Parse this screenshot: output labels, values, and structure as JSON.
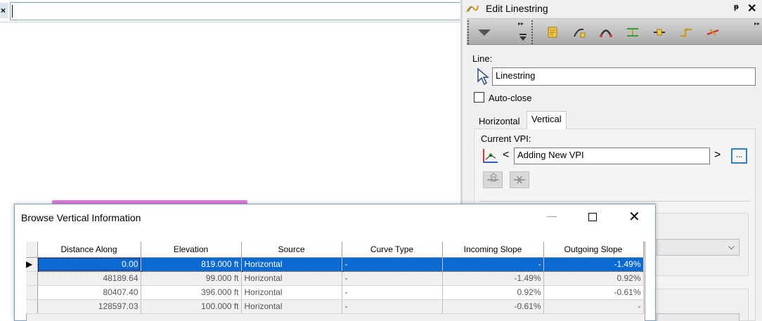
{
  "left_tab": {
    "close_glyph": "×"
  },
  "panel": {
    "title": "Edit Linestring",
    "pin_glyph": "ᵽ",
    "close_glyph": "✕",
    "line_label": "Line:",
    "line_value": "Linestring",
    "auto_close_label": "Auto-close",
    "tabs": [
      "Horizontal",
      "Vertical"
    ],
    "active_tab": "Vertical",
    "current_vpi_label": "Current VPI:",
    "current_vpi_value": "Adding New VPI",
    "prev_glyph": "<",
    "next_glyph": ">",
    "more_label": "...",
    "toolbar_icons": [
      "pointer-edit-icon",
      "add-point-icon",
      "arc-icon",
      "align-icon",
      "insert-icon",
      "step-icon",
      "delete-segment-icon"
    ],
    "colors": {
      "accent": "#2a7fd4"
    }
  },
  "dialog": {
    "title": "Browse Vertical Information",
    "columns": [
      "Distance Along",
      "Elevation",
      "Source",
      "Curve Type",
      "Incoming Slope",
      "Outgoing Slope"
    ],
    "rows": [
      [
        "0.00",
        "819.000 ft",
        "Horizontal",
        "-",
        "-",
        "-1.49%"
      ],
      [
        "48189.64",
        "99.000 ft",
        "Horizontal",
        "-",
        "-1.49%",
        "0.92%"
      ],
      [
        "80407.40",
        "396.000 ft",
        "Horizontal",
        "-",
        "0.92%",
        "-0.61%"
      ],
      [
        "128597.03",
        "100.000 ft",
        "Horizontal",
        "-",
        "-0.61%",
        "-"
      ]
    ],
    "selected_row": 0,
    "row_indicator": "▶",
    "colors": {
      "selection": "#0a6ad2"
    }
  }
}
